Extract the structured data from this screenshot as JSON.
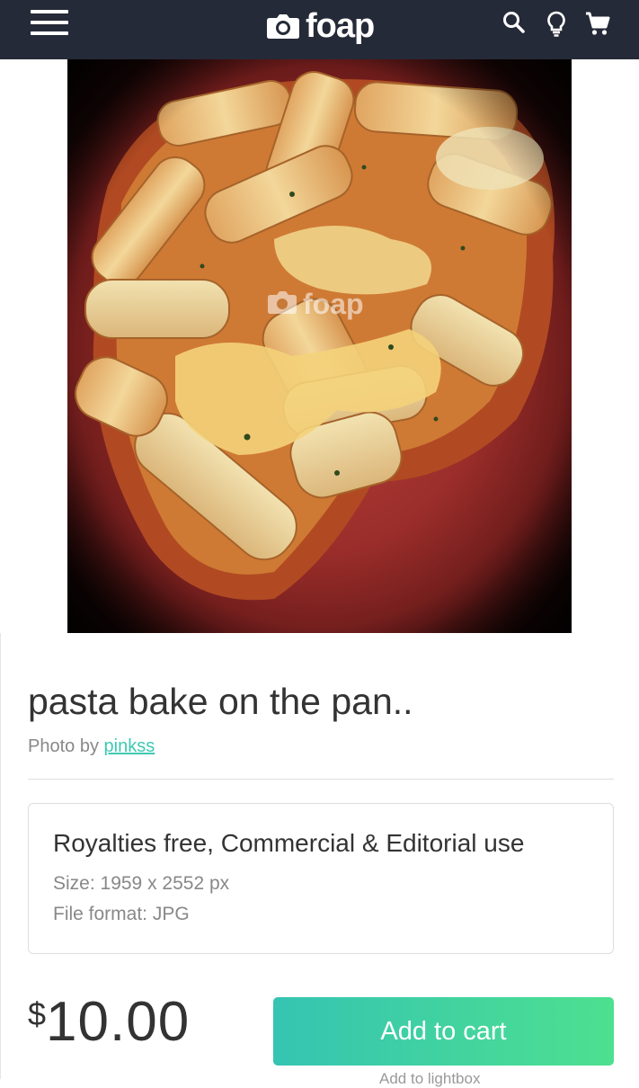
{
  "header": {
    "logo_text": "foap",
    "icons": [
      "menu-icon",
      "camera-logo-icon",
      "search-icon",
      "lightbulb-icon",
      "cart-icon"
    ],
    "background": "#252a38"
  },
  "photo": {
    "watermark": "foap"
  },
  "product": {
    "title": "pasta bake on the pan..",
    "byline_prefix": "Photo by",
    "author": "pinkss"
  },
  "license": {
    "title": "Royalties free, Commercial & Editorial use",
    "size": "Size: 1959 x 2552 px",
    "format": "File format: JPG"
  },
  "purchase": {
    "currency": "$",
    "amount": "10.00",
    "add_to_cart_label": "Add to cart",
    "button_gradient": [
      "#35c4b2",
      "#4de08f"
    ],
    "below_text": "Add to lightbox"
  },
  "colors": {
    "link": "#3ec9b3"
  }
}
